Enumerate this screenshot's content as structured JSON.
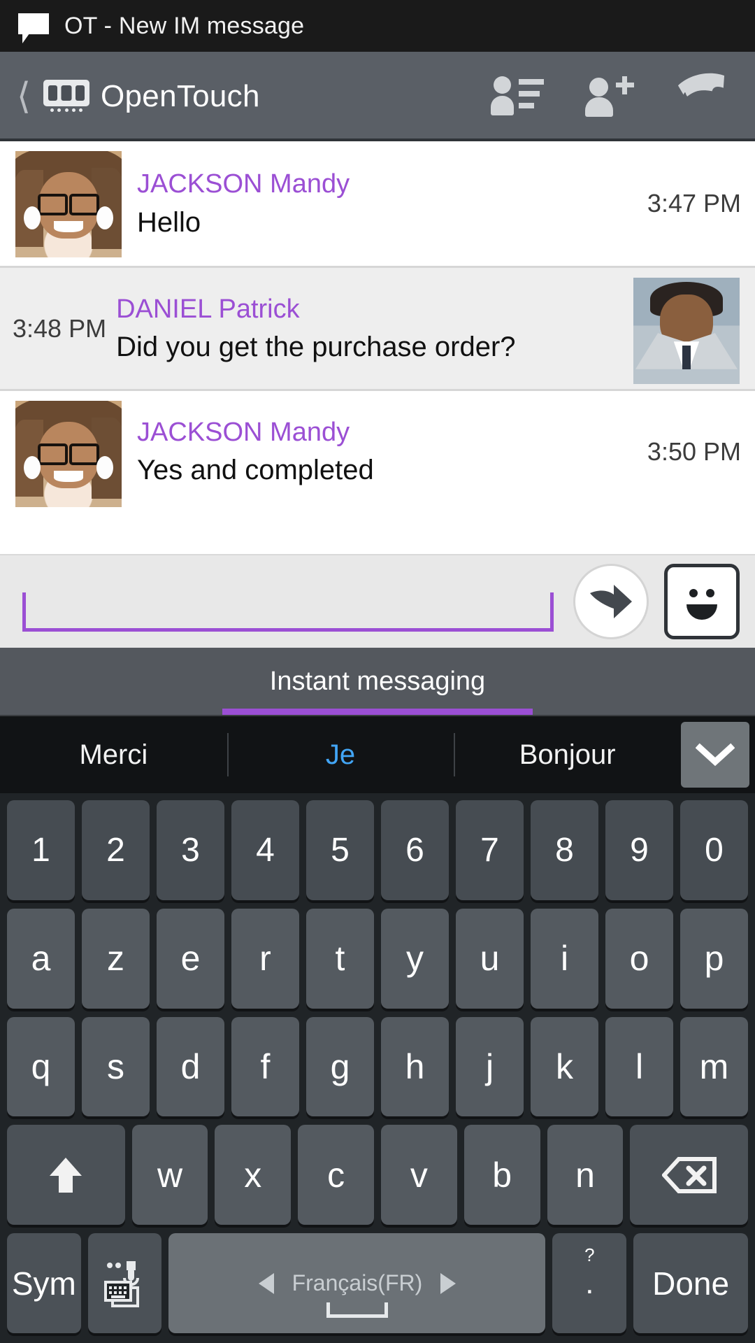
{
  "status_bar": {
    "icon": "message-bubble-icon",
    "text": "OT - New IM message"
  },
  "action_bar": {
    "back_icon": "back-chevron-icon",
    "logo_icon": "opentouch-logo-icon",
    "title": "OpenTouch",
    "actions": [
      {
        "name": "contacts-list-icon",
        "label": "Contacts"
      },
      {
        "name": "add-contact-icon",
        "label": "Add contact"
      },
      {
        "name": "call-icon",
        "label": "Call"
      }
    ]
  },
  "conversation": {
    "messages": [
      {
        "sender": "JACKSON Mandy",
        "text": "Hello",
        "time": "3:47 PM",
        "side": "left",
        "avatar": "mandy"
      },
      {
        "sender": "DANIEL Patrick",
        "text": "Did you get the purchase order?",
        "time": "3:48 PM",
        "side": "right",
        "avatar": "patrick"
      },
      {
        "sender": "JACKSON Mandy",
        "text": "Yes and completed",
        "time": "3:50 PM",
        "side": "left",
        "avatar": "mandy"
      }
    ]
  },
  "compose": {
    "input_value": "",
    "input_placeholder": "",
    "send_icon": "send-arrow-icon",
    "emoji_icon": "smiley-face-icon"
  },
  "tabs": {
    "active_label": "Instant messaging",
    "accent_color": "#9b4fd4"
  },
  "suggestions": {
    "items": [
      {
        "label": "Merci",
        "active": false
      },
      {
        "label": "Je",
        "active": true
      },
      {
        "label": "Bonjour",
        "active": false
      }
    ],
    "expand_icon": "chevron-down-icon",
    "active_color": "#42a5f5"
  },
  "keyboard": {
    "rows": {
      "numbers": [
        "1",
        "2",
        "3",
        "4",
        "5",
        "6",
        "7",
        "8",
        "9",
        "0"
      ],
      "row1": [
        "a",
        "z",
        "e",
        "r",
        "t",
        "y",
        "u",
        "i",
        "o",
        "p"
      ],
      "row2": [
        "q",
        "s",
        "d",
        "f",
        "g",
        "h",
        "j",
        "k",
        "l",
        "m"
      ],
      "row3": [
        "w",
        "x",
        "c",
        "v",
        "b",
        "n"
      ]
    },
    "shift_icon": "shift-up-arrow-icon",
    "backspace_icon": "backspace-icon",
    "sym_label": "Sym",
    "mic_icon": "mic-keyboard-icon",
    "space_label": "Français(FR)",
    "space_prev_icon": "left-triangle-icon",
    "space_next_icon": "right-triangle-icon",
    "period_label": ".",
    "period_sub": "?",
    "done_label": "Done"
  }
}
